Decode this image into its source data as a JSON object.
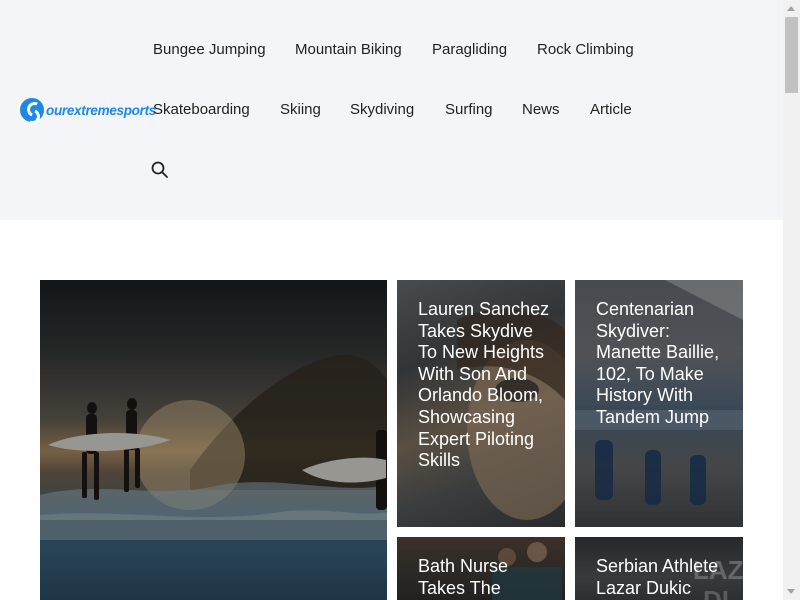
{
  "site": {
    "logo_text": "ourextremesports",
    "brand_color": "#1e88e5"
  },
  "nav": {
    "items": [
      {
        "label": "Bungee Jumping"
      },
      {
        "label": "Mountain Biking"
      },
      {
        "label": "Paragliding"
      },
      {
        "label": "Rock Climbing"
      },
      {
        "label": "Skateboarding"
      },
      {
        "label": "Skiing"
      },
      {
        "label": "Skydiving"
      },
      {
        "label": "Surfing"
      },
      {
        "label": "News"
      },
      {
        "label": "Article"
      }
    ],
    "search_icon": "search-icon"
  },
  "posts": [
    {
      "title": ""
    },
    {
      "title": "Lauren Sanchez Takes Skydive To New Heights With Son And Orlando Bloom, Showcasing Expert Piloting Skills"
    },
    {
      "title": "Centenarian Skydiver: Manette Baillie, 102, To Make History With Tandem Jump"
    },
    {
      "title": "Bath Nurse Takes The"
    },
    {
      "title": "Serbian Athlete Lazar Dukic"
    }
  ],
  "colors": {
    "header_bg": "#f4f5f8",
    "nav_text": "#222222",
    "title_text": "#ffffff"
  }
}
